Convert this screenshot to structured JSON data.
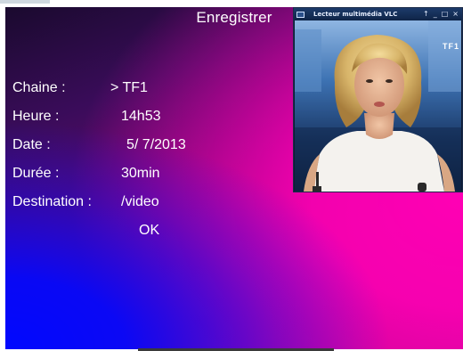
{
  "panel": {
    "title": "Enregistrer",
    "fields": [
      {
        "label": "Chaine :",
        "value": "> TF1"
      },
      {
        "label": "Heure :",
        "value": "14h53"
      },
      {
        "label": "Date :",
        "value": "5/ 7/2013"
      },
      {
        "label": "Durée :",
        "value": "30min"
      },
      {
        "label": "Destination :",
        "value": "/video"
      }
    ],
    "ok_label": "OK"
  },
  "vlc": {
    "title": "Lecteur multimédia VLC",
    "controls": [
      "↑",
      "_",
      "□",
      "×"
    ],
    "channel_logo": "TF1"
  }
}
